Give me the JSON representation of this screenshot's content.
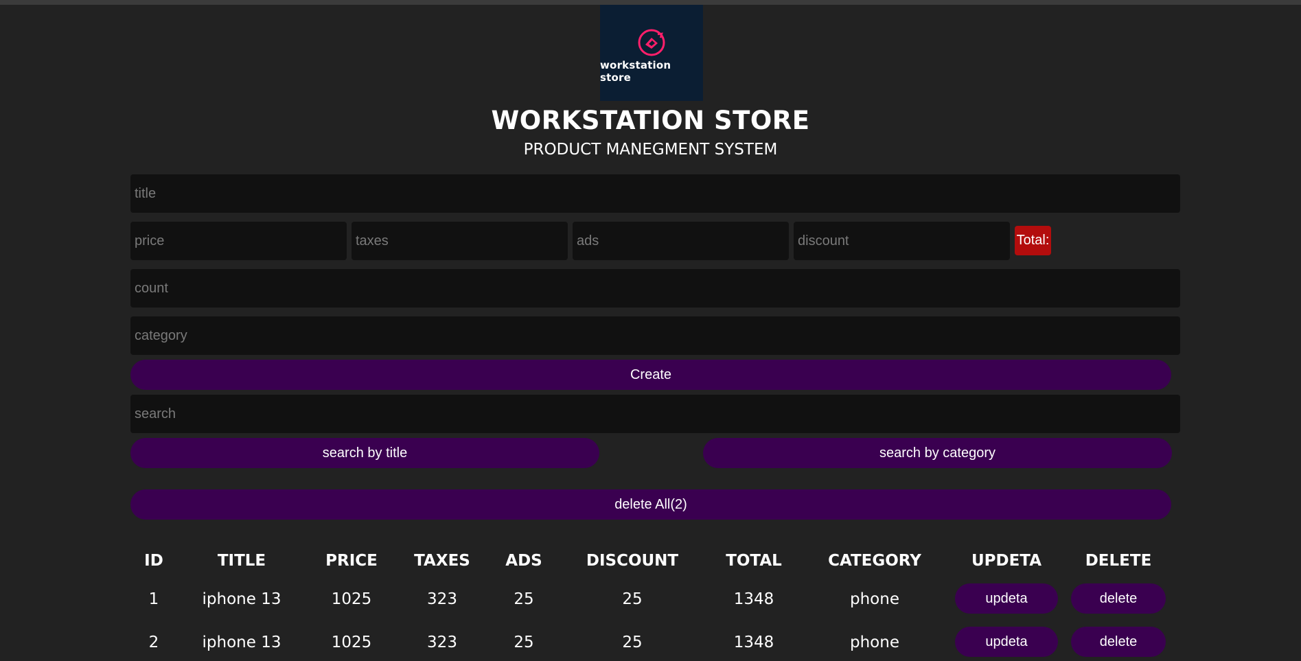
{
  "brand": {
    "logo_text": "workstation store",
    "title": "WORKSTATION STORE",
    "subtitle": "PRODUCT MANEGMENT SYSTEM",
    "logo_icon": "store-logo-icon",
    "accent_color": "#ff1f6b",
    "logo_bg": "#0b1e33"
  },
  "form": {
    "title_placeholder": "title",
    "price_placeholder": "price",
    "taxes_placeholder": "taxes",
    "ads_placeholder": "ads",
    "discount_placeholder": "discount",
    "total_label": "Total:",
    "count_placeholder": "count",
    "category_placeholder": "category",
    "create_label": "Create"
  },
  "search": {
    "placeholder": "search",
    "by_title_label": "search by title",
    "by_category_label": "search by category"
  },
  "delete_all_label": "delete All(2)",
  "table": {
    "headers": [
      "ID",
      "TITLE",
      "PRICE",
      "TAXES",
      "ADS",
      "DISCOUNT",
      "TOTAL",
      "CATEGORY",
      "UPDETA",
      "DELETE"
    ],
    "rows": [
      {
        "id": "1",
        "title": "iphone 13",
        "price": "1025",
        "taxes": "323",
        "ads": "25",
        "discount": "25",
        "total": "1348",
        "category": "phone",
        "update_label": "updeta",
        "delete_label": "delete"
      },
      {
        "id": "2",
        "title": "iphone 13",
        "price": "1025",
        "taxes": "323",
        "ads": "25",
        "discount": "25",
        "total": "1348",
        "category": "phone",
        "update_label": "updeta",
        "delete_label": "delete"
      }
    ]
  },
  "colors": {
    "background": "#222222",
    "input_bg": "#111111",
    "button_purple": "#3a0050",
    "total_red": "#b30d0d"
  }
}
